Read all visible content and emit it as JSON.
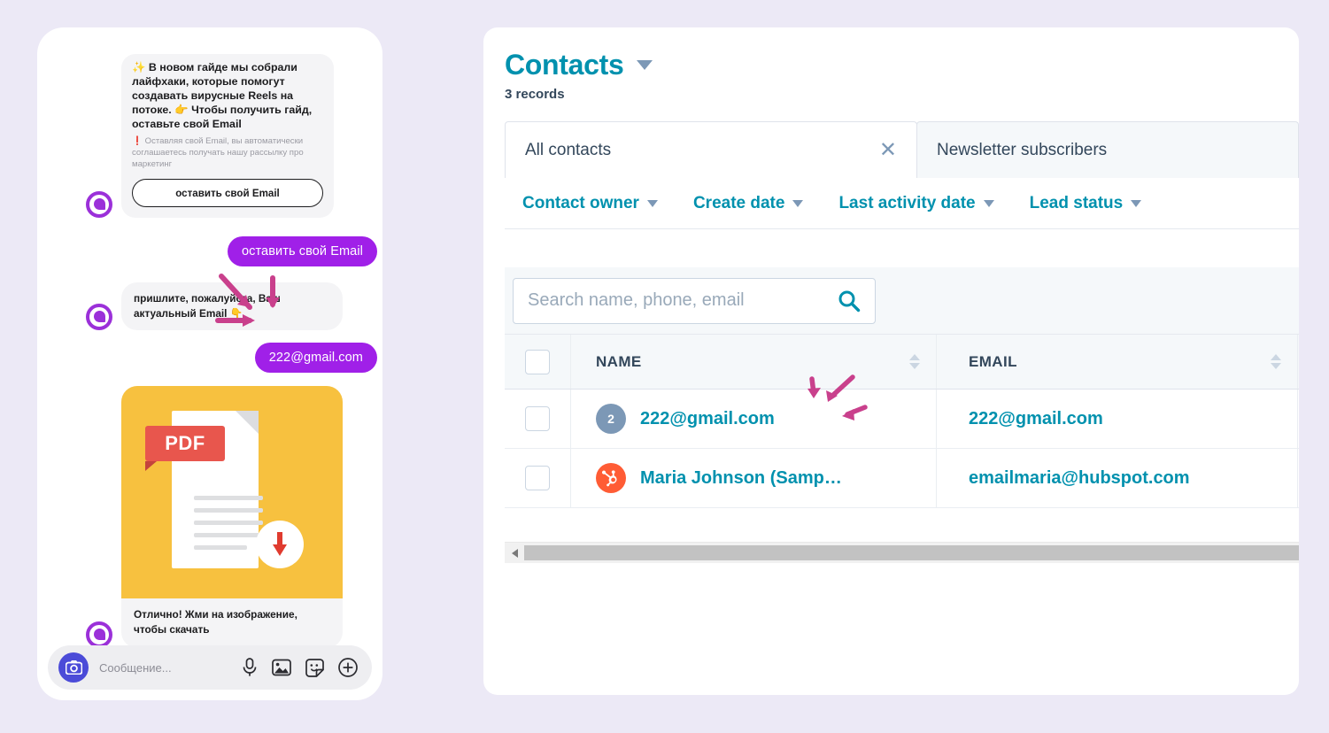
{
  "background_color": "#ece9f6",
  "chat": {
    "messages": [
      {
        "id": "m1",
        "type": "incoming",
        "headline": "✨ В новом гайде мы собрали лайфхаки, которые помогут создавать вирусные Reels на потоке. 👉 Чтобы получить гайд, оставьте свой Email",
        "disclaimer_bang": "❗",
        "disclaimer": "Оставляя свой Email, вы автоматически соглашаетесь получать нашу рассылку про маркетинг",
        "button_label": "оставить свой Email"
      },
      {
        "id": "m2",
        "type": "outgoing",
        "text": "оставить свой Email"
      },
      {
        "id": "m3",
        "type": "incoming",
        "text": "пришлите, пожалуйста, Ваш актуальный Email 👇"
      },
      {
        "id": "m4",
        "type": "outgoing",
        "text": "222@gmail.com"
      },
      {
        "id": "m5",
        "type": "incoming",
        "attachment_label": "PDF",
        "caption": "Отлично! Жми на изображение, чтобы скачать"
      }
    ],
    "input_bar": {
      "placeholder": "Сообщение...",
      "camera_icon": "camera-icon",
      "icons": [
        "microphone-icon",
        "photo-icon",
        "sticker-icon",
        "plus-circle-icon"
      ]
    },
    "colors": {
      "outgoing_bubble": "#a020e8",
      "incoming_bubble": "#f4f4f6",
      "avatar": "#9b30d9",
      "attachment_bg": "#f7c13f",
      "pdf_tag": "#e8564d",
      "annotation_arrow": "#c9408c"
    }
  },
  "hubspot": {
    "title": "Contacts",
    "title_caret": "chevron-down-icon",
    "records": "3 records",
    "tabs": [
      {
        "label": "All contacts",
        "active": true,
        "close_icon": "close-icon"
      },
      {
        "label": "Newsletter subscribers",
        "active": false
      }
    ],
    "filters": [
      {
        "label": "Contact owner",
        "caret": "chevron-down-icon"
      },
      {
        "label": "Create date",
        "caret": "chevron-down-icon"
      },
      {
        "label": "Last activity date",
        "caret": "chevron-down-icon"
      },
      {
        "label": "Lead status",
        "caret": "chevron-down-icon"
      }
    ],
    "search": {
      "placeholder": "Search name, phone, email",
      "icon": "search-icon"
    },
    "table": {
      "columns": [
        {
          "key": "checkbox",
          "label": ""
        },
        {
          "key": "name",
          "label": "NAME",
          "sortable": true
        },
        {
          "key": "email",
          "label": "EMAIL",
          "sortable": true
        }
      ],
      "rows": [
        {
          "checked": false,
          "avatar_text": "2",
          "avatar_color": "#7c98b6",
          "avatar_type": "initial-avatar",
          "name": "222@gmail.com",
          "email": "222@gmail.com"
        },
        {
          "checked": false,
          "avatar_text": "",
          "avatar_color": "#ff5c35",
          "avatar_type": "hubspot-sprocket-avatar",
          "name": "Maria Johnson (Samp…",
          "email": "emailmaria@hubspot.com"
        }
      ]
    },
    "scrollbar": {
      "left_arrow_icon": "chevron-left-icon"
    },
    "colors": {
      "brand_teal": "#0091ae",
      "text_dark": "#33475b",
      "header_bg": "#f5f8fa",
      "border": "#dfe3eb"
    }
  }
}
